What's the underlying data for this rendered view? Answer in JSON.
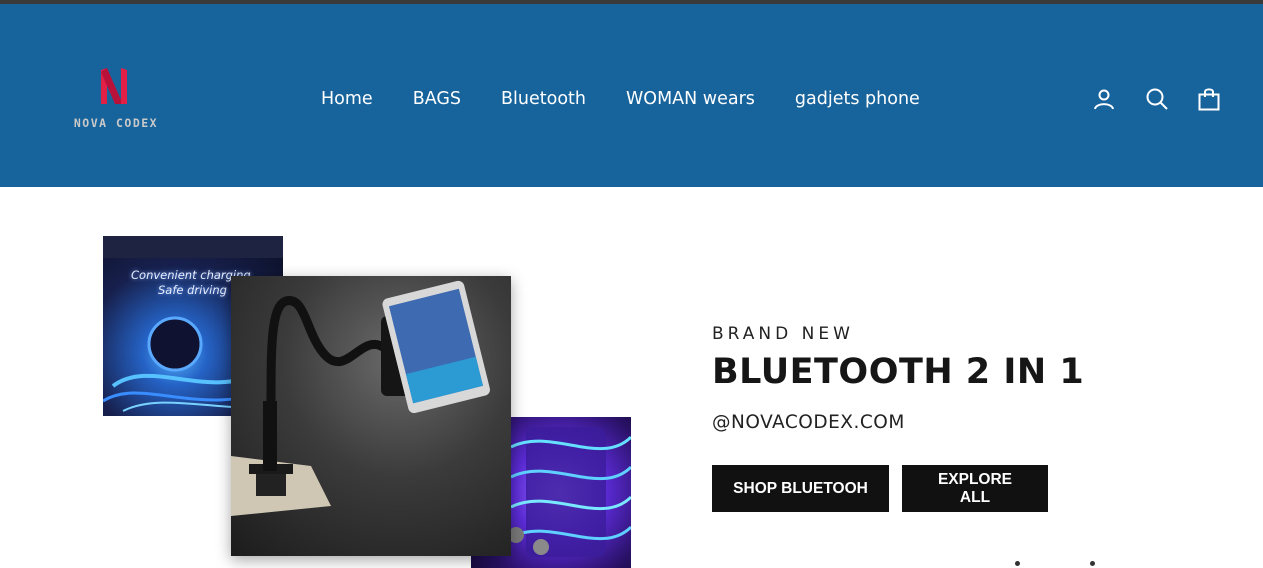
{
  "brand": {
    "name": "NOVA CODEX",
    "logo_icon": "n-letter-logo-icon",
    "logo_color": "#e21f45"
  },
  "nav": {
    "items": [
      {
        "label": "Home"
      },
      {
        "label": "BAGS"
      },
      {
        "label": "Bluetooth"
      },
      {
        "label": "WOMAN wears"
      },
      {
        "label": "gadjets phone"
      }
    ]
  },
  "header_icons": {
    "account": "user-icon",
    "search": "search-icon",
    "cart": "bag-icon"
  },
  "hero": {
    "images": {
      "top_left": {
        "line1": "Convenient charging",
        "line2": "Safe driving"
      }
    },
    "eyebrow": "BRAND NEW",
    "title": "BLUETOOTH 2 IN 1",
    "subtitle": "@NOVACODEX.COM",
    "primary_button": "SHOP BLUETOOH",
    "secondary_button": "EXPLORE ALL"
  },
  "colors": {
    "header_bg": "#17639c",
    "button_bg": "#111111",
    "text": "#161616"
  }
}
